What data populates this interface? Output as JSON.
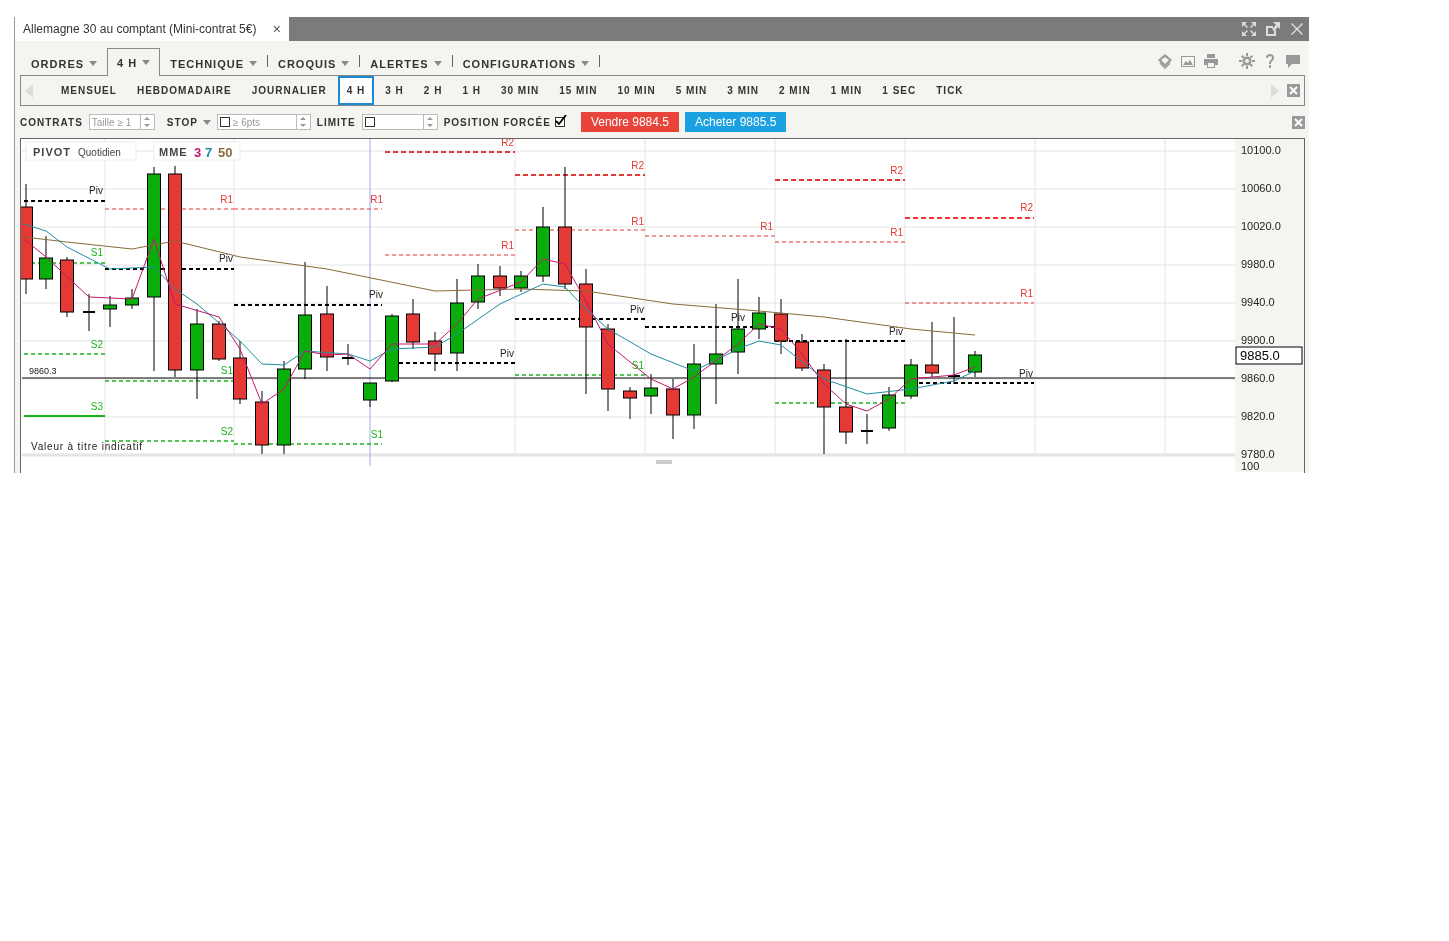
{
  "window": {
    "title": "Allemagne 30 au comptant (Mini-contrat 5€)",
    "close": "×"
  },
  "menu": [
    {
      "label": "ORDRES",
      "selected": false
    },
    {
      "label": "4 H",
      "selected": true
    },
    {
      "label": "TECHNIQUE",
      "selected": false
    },
    {
      "label": "CROQUIS",
      "selected": false
    },
    {
      "label": "ALERTES",
      "selected": false
    },
    {
      "label": "CONFIGURATIONS",
      "selected": false
    }
  ],
  "timeframes": [
    {
      "label": "MENSUEL",
      "selected": false
    },
    {
      "label": "HEBDOMADAIRE",
      "selected": false
    },
    {
      "label": "JOURNALIER",
      "selected": false
    },
    {
      "label": "4 H",
      "selected": true
    },
    {
      "label": "3 H",
      "selected": false
    },
    {
      "label": "2 H",
      "selected": false
    },
    {
      "label": "1 H",
      "selected": false
    },
    {
      "label": "30 MIN",
      "selected": false
    },
    {
      "label": "15 MIN",
      "selected": false
    },
    {
      "label": "10 MIN",
      "selected": false
    },
    {
      "label": "5 MIN",
      "selected": false
    },
    {
      "label": "3 MIN",
      "selected": false
    },
    {
      "label": "2 MIN",
      "selected": false
    },
    {
      "label": "1 MIN",
      "selected": false
    },
    {
      "label": "1 SEC",
      "selected": false
    },
    {
      "label": "TICK",
      "selected": false
    }
  ],
  "order_bar": {
    "contracts_label": "CONTRATS",
    "contracts_placeholder": "Taille ≥ 1",
    "stop_label": "STOP",
    "stop_checked": false,
    "stop_placeholder": "≥ 6pts",
    "limit_label": "LIMITE",
    "limit_checked": false,
    "forced_label": "POSITION FORCÉE",
    "forced_checked": true,
    "sell": "Vendre 9884.5",
    "buy": "Acheter 9885.5"
  },
  "chart": {
    "pivot_label": "PIVOT",
    "pivot_period": "Quotidien",
    "ema_label": "MME",
    "ema_periods": [
      {
        "label": "3",
        "color": "#c0186e"
      },
      {
        "label": "7",
        "color": "#1f8fa0"
      },
      {
        "label": "50",
        "color": "#8a6a3a"
      }
    ],
    "last_close": "9860.3",
    "disclaimer": "Valeur à titre indicatif",
    "price": "9885.0",
    "yaxis": [
      "10100.0",
      "10060.0",
      "10020.0",
      "9980.0",
      "9940.0",
      "9900.0",
      "9860.0",
      "9820.0",
      "9780.0"
    ],
    "yaxis_cut": "100",
    "pivots": [
      {
        "text": "Piv",
        "kind": "piv"
      },
      {
        "text": "S1",
        "kind": "s"
      },
      {
        "text": "S2",
        "kind": "s"
      },
      {
        "text": "S3",
        "kind": "s3"
      },
      {
        "text": "R1",
        "kind": "r"
      },
      {
        "text": "Piv",
        "kind": "piv"
      },
      {
        "text": "S1",
        "kind": "s"
      },
      {
        "text": "S2",
        "kind": "s"
      },
      {
        "text": "R1",
        "kind": "r"
      },
      {
        "text": "Piv",
        "kind": "piv"
      },
      {
        "text": "S1",
        "kind": "s"
      },
      {
        "text": "R2",
        "kind": "r2"
      },
      {
        "text": "R1",
        "kind": "r"
      },
      {
        "text": "Piv",
        "kind": "piv"
      },
      {
        "text": "R2",
        "kind": "r2"
      },
      {
        "text": "R1",
        "kind": "r"
      },
      {
        "text": "Piv",
        "kind": "piv"
      },
      {
        "text": "S1",
        "kind": "s"
      },
      {
        "text": "R1",
        "kind": "r"
      },
      {
        "text": "Piv",
        "kind": "piv"
      },
      {
        "text": "R2",
        "kind": "r2"
      },
      {
        "text": "R1",
        "kind": "r"
      },
      {
        "text": "Piv",
        "kind": "piv"
      },
      {
        "text": "R2",
        "kind": "r2"
      },
      {
        "text": "R1",
        "kind": "r"
      },
      {
        "text": "Piv",
        "kind": "piv"
      }
    ]
  }
}
